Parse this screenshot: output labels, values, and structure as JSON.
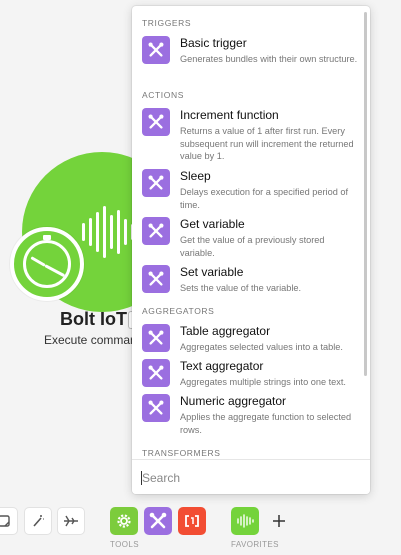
{
  "colors": {
    "module_green": "#74d33b",
    "tool_purple": "#9b6fe0",
    "tool_green": "#7ccc3c",
    "tool_red": "#f24d33"
  },
  "module": {
    "title": "Bolt IoT",
    "subtitle": "Execute command",
    "icon": "sound-wave-icon",
    "badge_icon": "clock-icon"
  },
  "dropdown": {
    "sections": [
      {
        "header": "TRIGGERS",
        "items": [
          {
            "title": "Basic trigger",
            "desc": "Generates bundles with their own structure.",
            "icon": "tools-icon"
          }
        ]
      },
      {
        "header": "ACTIONS",
        "items": [
          {
            "title": "Increment function",
            "desc": "Returns a value of 1 after first run. Every subsequent run will increment the returned value by 1.",
            "icon": "tools-icon"
          },
          {
            "title": "Sleep",
            "desc": "Delays execution for a specified period of time.",
            "icon": "tools-icon"
          },
          {
            "title": "Get variable",
            "desc": "Get the value of a previously stored variable.",
            "icon": "tools-icon"
          },
          {
            "title": "Set variable",
            "desc": "Sets the value of the variable.",
            "icon": "tools-icon"
          }
        ]
      },
      {
        "header": "AGGREGATORS",
        "items": [
          {
            "title": "Table aggregator",
            "desc": "Aggregates selected values into a table.",
            "icon": "tools-icon"
          },
          {
            "title": "Text aggregator",
            "desc": "Aggregates multiple strings into one text.",
            "icon": "tools-icon"
          },
          {
            "title": "Numeric aggregator",
            "desc": "Applies the aggregate function to selected rows.",
            "icon": "tools-icon"
          }
        ]
      },
      {
        "header": "TRANSFORMERS",
        "items": []
      }
    ],
    "search": {
      "placeholder": "Search",
      "value": ""
    }
  },
  "toolbar": {
    "tools_label": "TOOLS",
    "favorites_label": "FAVORITES",
    "buttons": [
      "note-icon",
      "magic-wand-icon",
      "airplane-icon",
      "gear-icon",
      "tools-icon",
      "brackets-icon",
      "sound-wave-icon",
      "plus-icon"
    ]
  }
}
